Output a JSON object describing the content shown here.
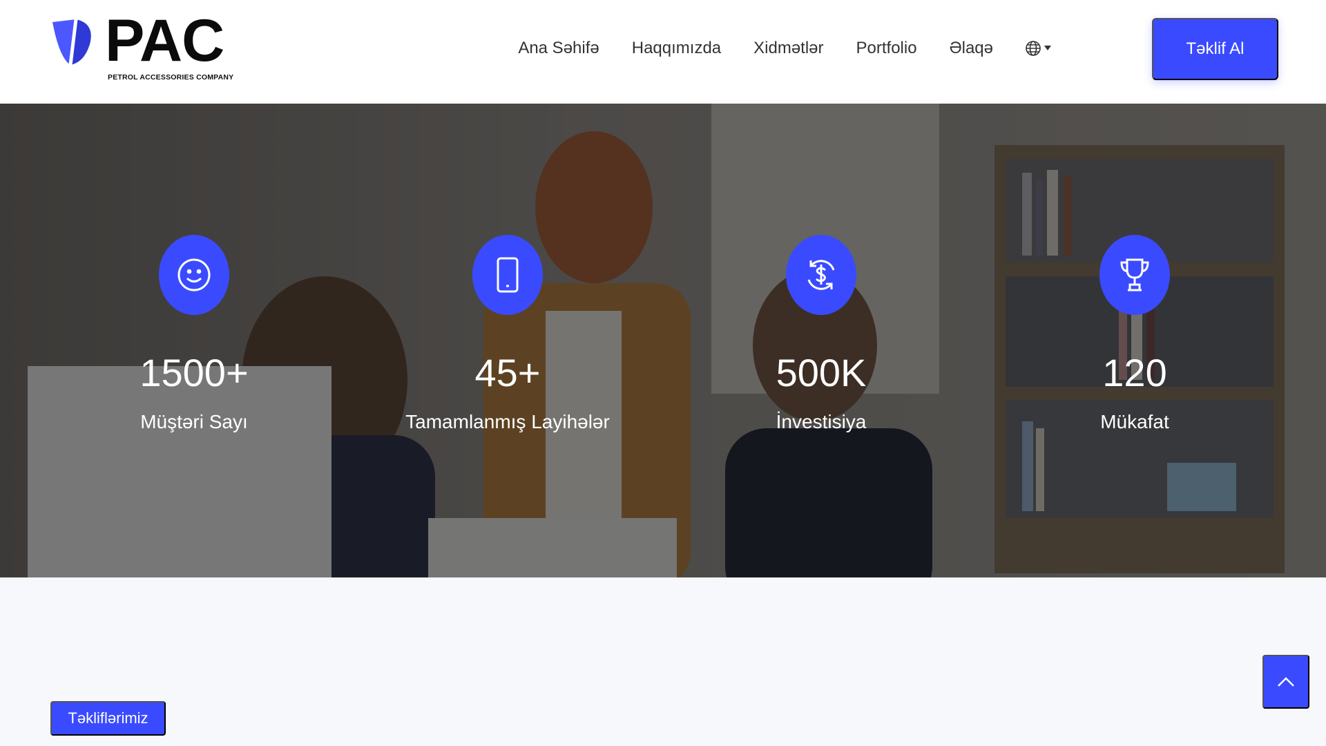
{
  "header": {
    "logo": {
      "wordmark": "PAC",
      "subtitle": "PETROL ACCESSORIES COMPANY"
    },
    "nav": [
      {
        "label": "Ana Səhifə"
      },
      {
        "label": "Haqqımızda"
      },
      {
        "label": "Xidmətlər"
      },
      {
        "label": "Portfolio"
      },
      {
        "label": "Əlaqə"
      }
    ],
    "language_icon": "globe-icon",
    "cta_label": "Təklif Al"
  },
  "stats": [
    {
      "icon": "smiley-icon",
      "value": "1500+",
      "label": "Müştəri Sayı"
    },
    {
      "icon": "tablet-icon",
      "value": "45+",
      "label": "Tamamlanmış Layihələr"
    },
    {
      "icon": "dollar-cycle-icon",
      "value": "500K",
      "label": "İnvestisiya"
    },
    {
      "icon": "trophy-icon",
      "value": "120",
      "label": "Mükafat"
    }
  ],
  "offers_label": "Təkliflərimiz",
  "scroll_top_icon": "chevron-up-icon",
  "colors": {
    "accent": "#3a4bff",
    "header_bg": "#ffffff",
    "page_bg": "#f7f8fc"
  }
}
